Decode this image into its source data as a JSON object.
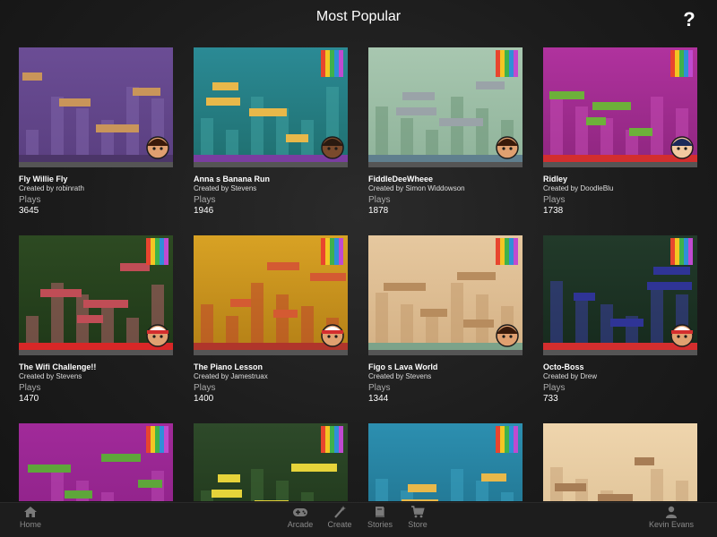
{
  "header": {
    "title": "Most Popular",
    "help_label": "?"
  },
  "plays_label": "Plays",
  "games": [
    {
      "title": "Fly Willie Fly",
      "creator": "Created by robinrath",
      "plays": "3645",
      "theme": "purple",
      "avatar": "willie"
    },
    {
      "title": "Anna s Banana Run",
      "creator": "Created by Stevens",
      "plays": "1946",
      "theme": "teal",
      "avatar": "anna"
    },
    {
      "title": "FiddleDeeWheee",
      "creator": "Created by Simon Widdowson",
      "plays": "1878",
      "theme": "mint",
      "avatar": "willie"
    },
    {
      "title": "Ridley",
      "creator": "Created by DoodleBlu",
      "plays": "1738",
      "theme": "magenta",
      "avatar": "ridley"
    },
    {
      "title": "The Wifi Challenge!!",
      "creator": "Created by Stevens",
      "plays": "1470",
      "theme": "jungle",
      "avatar": "cap"
    },
    {
      "title": "The Piano Lesson",
      "creator": "Created by Jamestruax",
      "plays": "1400",
      "theme": "amber",
      "avatar": "cap"
    },
    {
      "title": "Figo s Lava World",
      "creator": "Created by Stevens",
      "plays": "1344",
      "theme": "beige",
      "avatar": "figo"
    },
    {
      "title": "Octo-Boss",
      "creator": "Created by Drew",
      "plays": "733",
      "theme": "darkgreen",
      "avatar": "cap"
    },
    {
      "title": "",
      "creator": "",
      "plays": "",
      "theme": "purple2",
      "avatar": ""
    },
    {
      "title": "",
      "creator": "",
      "plays": "",
      "theme": "forest",
      "avatar": ""
    },
    {
      "title": "",
      "creator": "",
      "plays": "",
      "theme": "teal2",
      "avatar": ""
    },
    {
      "title": "",
      "creator": "",
      "plays": "",
      "theme": "beige2",
      "avatar": ""
    }
  ],
  "bottom_nav": {
    "home": {
      "label": "Home",
      "icon": "home-icon"
    },
    "arcade": {
      "label": "Arcade",
      "icon": "gamepad-icon"
    },
    "create": {
      "label": "Create",
      "icon": "magic-wand-icon"
    },
    "stories": {
      "label": "Stories",
      "icon": "book-icon"
    },
    "store": {
      "label": "Store",
      "icon": "cart-icon"
    },
    "account": {
      "label": "Kevin Evans",
      "icon": "user-icon"
    }
  },
  "colors": {
    "background": "#1b1b1b",
    "nav_text": "#8a8a8a",
    "thumb_border": "#555555"
  }
}
